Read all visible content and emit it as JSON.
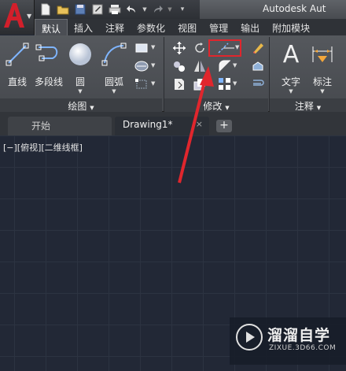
{
  "title_bar": {
    "app_title": "Autodesk Aut"
  },
  "ribbon_tabs": [
    "默认",
    "插入",
    "注释",
    "参数化",
    "视图",
    "管理",
    "输出",
    "附加模块"
  ],
  "draw_panel": {
    "buttons": [
      "直线",
      "多段线",
      "圆",
      "圆弧"
    ],
    "title": "绘图"
  },
  "modify_panel": {
    "title": "修改"
  },
  "annotation_panel": {
    "buttons": [
      "文字",
      "标注"
    ],
    "title": "注释"
  },
  "file_tabs": {
    "start": "开始",
    "drawing": "Drawing1*",
    "close": "×",
    "new_tab": "+"
  },
  "viewport": {
    "label": "[−][俯视][二维线框]"
  },
  "watermark": {
    "name": "溜溜自学",
    "url": "ZIXUE.3D66.COM"
  },
  "colors": {
    "highlight": "#e0262d",
    "canvas": "#222836",
    "brand": "#c8102e"
  }
}
